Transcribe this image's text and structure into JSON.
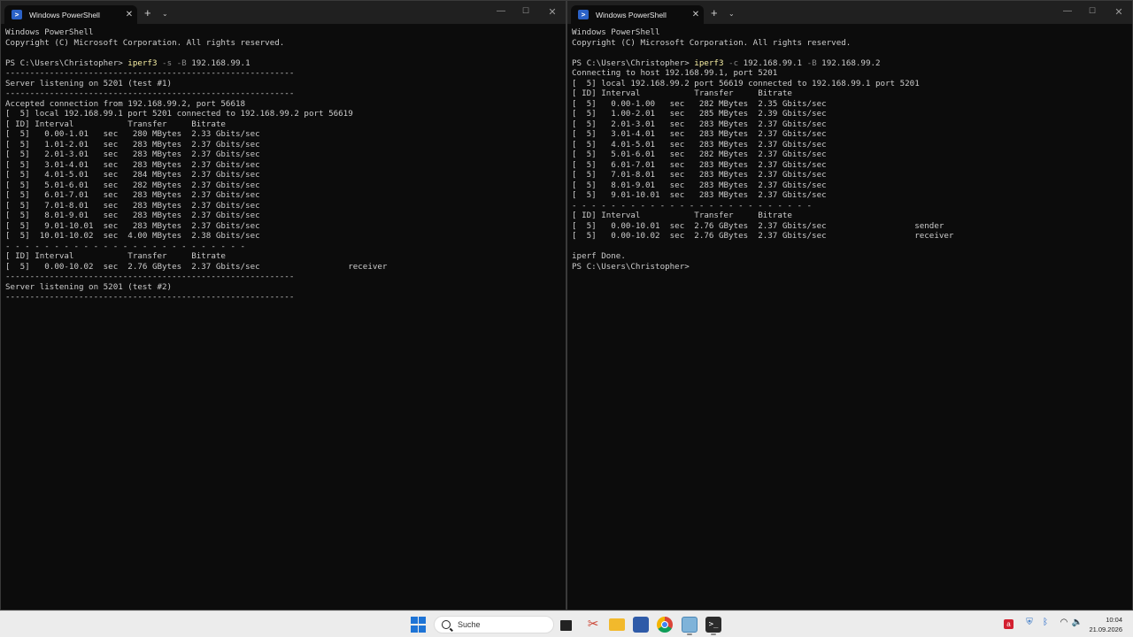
{
  "left_window": {
    "tab_title": "Windows PowerShell",
    "lines": [
      [
        {
          "t": "Windows PowerShell"
        }
      ],
      [
        {
          "t": "Copyright (C) Microsoft Corporation. All rights reserved."
        }
      ],
      [
        {
          "t": ""
        }
      ],
      [
        {
          "t": "PS C:\\Users\\Christopher> "
        },
        {
          "t": "iperf3",
          "c": "cmd"
        },
        {
          "t": " -s -B ",
          "c": "param"
        },
        {
          "t": "192.168.99.1"
        }
      ],
      [
        {
          "t": "-----------------------------------------------------------"
        }
      ],
      [
        {
          "t": "Server listening on 5201 (test #1)"
        }
      ],
      [
        {
          "t": "-----------------------------------------------------------"
        }
      ],
      [
        {
          "t": "Accepted connection from 192.168.99.2, port 56618"
        }
      ],
      [
        {
          "t": "[  5] local 192.168.99.1 port 5201 connected to 192.168.99.2 port 56619"
        }
      ],
      [
        {
          "t": "[ ID] Interval           Transfer     Bitrate"
        }
      ],
      [
        {
          "t": "[  5]   0.00-1.01   sec   280 MBytes  2.33 Gbits/sec"
        }
      ],
      [
        {
          "t": "[  5]   1.01-2.01   sec   283 MBytes  2.37 Gbits/sec"
        }
      ],
      [
        {
          "t": "[  5]   2.01-3.01   sec   283 MBytes  2.37 Gbits/sec"
        }
      ],
      [
        {
          "t": "[  5]   3.01-4.01   sec   283 MBytes  2.37 Gbits/sec"
        }
      ],
      [
        {
          "t": "[  5]   4.01-5.01   sec   284 MBytes  2.37 Gbits/sec"
        }
      ],
      [
        {
          "t": "[  5]   5.01-6.01   sec   282 MBytes  2.37 Gbits/sec"
        }
      ],
      [
        {
          "t": "[  5]   6.01-7.01   sec   283 MBytes  2.37 Gbits/sec"
        }
      ],
      [
        {
          "t": "[  5]   7.01-8.01   sec   283 MBytes  2.37 Gbits/sec"
        }
      ],
      [
        {
          "t": "[  5]   8.01-9.01   sec   283 MBytes  2.37 Gbits/sec"
        }
      ],
      [
        {
          "t": "[  5]   9.01-10.01  sec   283 MBytes  2.37 Gbits/sec"
        }
      ],
      [
        {
          "t": "[  5]  10.01-10.02  sec  4.00 MBytes  2.38 Gbits/sec"
        }
      ],
      [
        {
          "t": "- - - - - - - - - - - - - - - - - - - - - - - - -"
        }
      ],
      [
        {
          "t": "[ ID] Interval           Transfer     Bitrate"
        }
      ],
      [
        {
          "t": "[  5]   0.00-10.02  sec  2.76 GBytes  2.37 Gbits/sec                  receiver"
        }
      ],
      [
        {
          "t": "-----------------------------------------------------------"
        }
      ],
      [
        {
          "t": "Server listening on 5201 (test #2)"
        }
      ],
      [
        {
          "t": "-----------------------------------------------------------"
        }
      ]
    ]
  },
  "right_window": {
    "tab_title": "Windows PowerShell",
    "lines": [
      [
        {
          "t": "Windows PowerShell"
        }
      ],
      [
        {
          "t": "Copyright (C) Microsoft Corporation. All rights reserved."
        }
      ],
      [
        {
          "t": ""
        }
      ],
      [
        {
          "t": "PS C:\\Users\\Christopher> "
        },
        {
          "t": "iperf3",
          "c": "cmd"
        },
        {
          "t": " -c ",
          "c": "param"
        },
        {
          "t": "192.168.99.1"
        },
        {
          "t": " -B ",
          "c": "param"
        },
        {
          "t": "192.168.99.2"
        }
      ],
      [
        {
          "t": "Connecting to host 192.168.99.1, port 5201"
        }
      ],
      [
        {
          "t": "[  5] local 192.168.99.2 port 56619 connected to 192.168.99.1 port 5201"
        }
      ],
      [
        {
          "t": "[ ID] Interval           Transfer     Bitrate"
        }
      ],
      [
        {
          "t": "[  5]   0.00-1.00   sec   282 MBytes  2.35 Gbits/sec"
        }
      ],
      [
        {
          "t": "[  5]   1.00-2.01   sec   285 MBytes  2.39 Gbits/sec"
        }
      ],
      [
        {
          "t": "[  5]   2.01-3.01   sec   283 MBytes  2.37 Gbits/sec"
        }
      ],
      [
        {
          "t": "[  5]   3.01-4.01   sec   283 MBytes  2.37 Gbits/sec"
        }
      ],
      [
        {
          "t": "[  5]   4.01-5.01   sec   283 MBytes  2.37 Gbits/sec"
        }
      ],
      [
        {
          "t": "[  5]   5.01-6.01   sec   282 MBytes  2.37 Gbits/sec"
        }
      ],
      [
        {
          "t": "[  5]   6.01-7.01   sec   283 MBytes  2.37 Gbits/sec"
        }
      ],
      [
        {
          "t": "[  5]   7.01-8.01   sec   283 MBytes  2.37 Gbits/sec"
        }
      ],
      [
        {
          "t": "[  5]   8.01-9.01   sec   283 MBytes  2.37 Gbits/sec"
        }
      ],
      [
        {
          "t": "[  5]   9.01-10.01  sec   283 MBytes  2.37 Gbits/sec"
        }
      ],
      [
        {
          "t": "- - - - - - - - - - - - - - - - - - - - - - - - -"
        }
      ],
      [
        {
          "t": "[ ID] Interval           Transfer     Bitrate"
        }
      ],
      [
        {
          "t": "[  5]   0.00-10.01  sec  2.76 GBytes  2.37 Gbits/sec                  sender"
        }
      ],
      [
        {
          "t": "[  5]   0.00-10.02  sec  2.76 GBytes  2.37 Gbits/sec                  receiver"
        }
      ],
      [
        {
          "t": ""
        }
      ],
      [
        {
          "t": "iperf Done."
        }
      ],
      [
        {
          "t": "PS C:\\Users\\Christopher>"
        }
      ]
    ]
  },
  "taskbar": {
    "search_placeholder": "Suche",
    "time": "10:04",
    "date": "21.09.2026"
  },
  "colors": {
    "console_bg": "#0c0c0c",
    "console_text": "#cccccc",
    "command": "#f9f1a5",
    "parameter": "#8a8a8a",
    "accent": "#1e74d6"
  }
}
